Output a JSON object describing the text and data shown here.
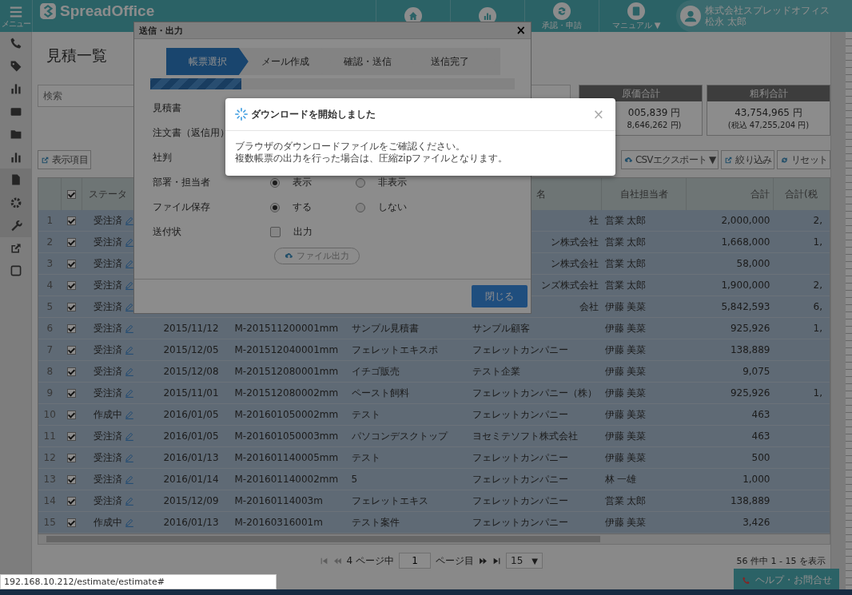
{
  "header": {
    "menu_label": "メニュー",
    "logo": "SpreadOffice",
    "nav": [
      {
        "kind": "home"
      },
      {
        "kind": "chart"
      },
      {
        "kind": "sync",
        "label": "承認・申請"
      },
      {
        "kind": "book",
        "label": "マニュアル ▼"
      }
    ],
    "user": {
      "company": "株式会社スプレッドオフィス",
      "name": "松永 太郎"
    }
  },
  "page": {
    "title": "見積一覧",
    "search": {
      "placeholder": "検索"
    },
    "summary": [
      {
        "heading": "原価合計",
        "amount": "005,839 円",
        "tax": "8,646,262 円)"
      },
      {
        "heading": "粗利合計",
        "amount": "43,754,965 円",
        "tax": "(税込 47,255,204 円)"
      }
    ],
    "toolbar_left": [
      {
        "kind": "columns",
        "label": "表示項目"
      }
    ],
    "toolbar_right": [
      {
        "kind": "export",
        "label": "CSVエクスポート ▼"
      },
      {
        "kind": "filter",
        "label": "絞り込み"
      },
      {
        "kind": "reset",
        "label": "リセット"
      }
    ]
  },
  "table": {
    "header_checked": true,
    "columns": [
      "",
      "",
      "ステータ",
      "",
      "",
      "",
      "名",
      "自社担当者",
      "合計",
      "合計(税"
    ],
    "rows": [
      {
        "no": "1",
        "checked": true,
        "status": "受注済",
        "customer": "社",
        "staff": "営業 太郎",
        "total": "2,000,000",
        "total_tax": "2,"
      },
      {
        "no": "2",
        "checked": true,
        "status": "受注済",
        "customer": "ン株式会社",
        "staff": "営業 太郎",
        "total": "1,668,000",
        "total_tax": "1,"
      },
      {
        "no": "3",
        "checked": true,
        "status": "受注済",
        "customer": "ン株式会社",
        "staff": "営業 太郎",
        "total": "58,000"
      },
      {
        "no": "4",
        "checked": true,
        "status": "受注済",
        "customer": "ンズ株式会社",
        "staff": "営業 太郎",
        "total": "1,900,000",
        "total_tax": "2,"
      },
      {
        "no": "5",
        "checked": true,
        "status": "受注済",
        "customer": "会社",
        "staff": "伊藤 美菜",
        "total": "5,842,593",
        "total_tax": "6,"
      },
      {
        "no": "6",
        "checked": true,
        "status": "受注済",
        "date": "2015/11/12",
        "number": "M-201511200001mm",
        "subject": "サンプル見積書",
        "customer": "サンプル顧客",
        "staff": "伊藤 美菜",
        "total": "925,926",
        "total_tax": "1,"
      },
      {
        "no": "7",
        "checked": true,
        "status": "受注済",
        "date": "2015/12/05",
        "number": "M-201512040001mm",
        "subject": "フェレットエキスポ",
        "customer": "フェレットカンパニー",
        "staff": "伊藤 美菜",
        "total": "138,889"
      },
      {
        "no": "8",
        "checked": true,
        "status": "受注済",
        "date": "2015/12/08",
        "number": "M-201512080001mm",
        "subject": "イチゴ販売",
        "customer": "テスト企業",
        "staff": "伊藤 美菜",
        "total": "9,075"
      },
      {
        "no": "9",
        "checked": true,
        "status": "受注済",
        "date": "2015/11/01",
        "number": "M-201512080002mm",
        "subject": "ペースト飼料",
        "customer": "フェレットカンパニー（株）",
        "staff": "伊藤 美菜",
        "total": "925,926",
        "total_tax": "1,"
      },
      {
        "no": "10",
        "checked": true,
        "status": "作成中",
        "date": "2016/01/05",
        "number": "M-201601050002mm",
        "subject": "テスト",
        "customer": "フェレットカンパニー",
        "staff": "伊藤 美菜",
        "total": "463"
      },
      {
        "no": "11",
        "checked": true,
        "status": "受注済",
        "date": "2016/01/05",
        "number": "M-201601050003mm",
        "subject": "パソコンデスクトップ",
        "customer": "ヨセミテソフト株式会社",
        "staff": "伊藤 美菜",
        "total": "463"
      },
      {
        "no": "12",
        "checked": true,
        "status": "受注済",
        "date": "2016/01/13",
        "number": "M-201601140005mm",
        "subject": "テスト",
        "customer": "フェレットカンパニー",
        "staff": "伊藤 美菜",
        "total": "500"
      },
      {
        "no": "13",
        "checked": true,
        "status": "受注済",
        "date": "2016/01/14",
        "number": "M-201601140002mm",
        "subject": "5",
        "customer": "フェレットカンパニー",
        "staff": "林 一雄",
        "total": "1,000"
      },
      {
        "no": "14",
        "checked": true,
        "status": "受注済",
        "date": "2015/12/09",
        "number": "M-20160114003m",
        "subject": "フェレットエキス",
        "customer": "フェレットカンパニー",
        "staff": "営業 太郎",
        "total": "138,889"
      },
      {
        "no": "15",
        "checked": true,
        "status": "作成中",
        "date": "2016/01/13",
        "number": "M-20160316001m",
        "subject": "テスト案件",
        "customer": "フェレットカンパニー",
        "staff": "伊藤 美菜",
        "total": "3,426"
      }
    ]
  },
  "pagination": {
    "pages_label": "4 ページ中",
    "page": "1",
    "page_label": "ページ目",
    "per_page": "15",
    "caret": "▼",
    "summary": "56 件中 1 - 15 を表示"
  },
  "help_button": "ヘルプ・お問合せ",
  "status_url": "192.168.10.212/estimate/estimate#",
  "modal": {
    "title": "送信・出力",
    "close": "×",
    "steps": [
      {
        "label": "帳票選択",
        "selected": true
      },
      {
        "label": "メール作成",
        "selected": false
      },
      {
        "label": "確認・送信",
        "selected": false
      },
      {
        "label": "送信完了",
        "selected": false
      }
    ],
    "progress": {
      "level": 0.25
    },
    "rows": [
      {
        "kind": "label",
        "label": "見積書"
      },
      {
        "kind": "label",
        "label": "注文書（返信用）"
      },
      {
        "kind": "label",
        "label": "社判"
      },
      {
        "kind": "radio",
        "label": "部署・担当者",
        "options": [
          {
            "label": "表示",
            "selected": true
          },
          {
            "label": "非表示",
            "selected": false
          }
        ]
      },
      {
        "kind": "radio",
        "label": "ファイル保存",
        "options": [
          {
            "label": "する",
            "selected": true
          },
          {
            "label": "しない",
            "selected": false
          }
        ]
      },
      {
        "kind": "checkbox",
        "label": "送付状",
        "option": "出力",
        "checked": false
      }
    ],
    "export_button": {
      "label": "ファイル出力",
      "disabled": true
    },
    "close_button": "閉じる"
  },
  "toast": {
    "title": "ダウンロードを開始しました",
    "close": "×",
    "lines": [
      "ブラウザのダウンロードファイルをご確認ください。",
      "複数帳票の出力を行った場合は、圧縮zipファイルとなります。"
    ]
  }
}
